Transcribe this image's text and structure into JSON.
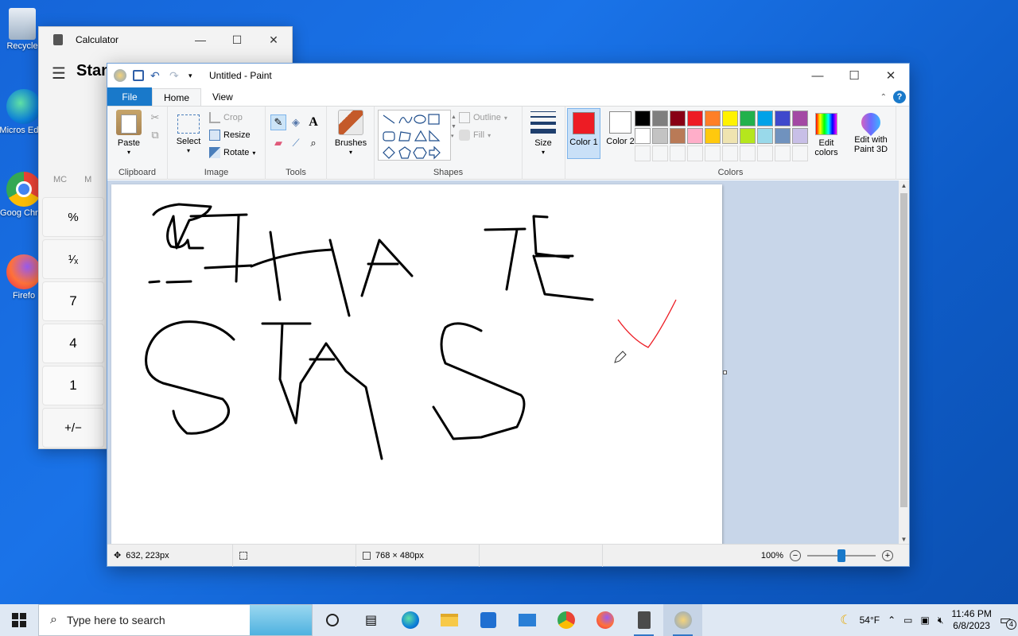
{
  "desktop": {
    "icons": [
      {
        "label": "Recycle",
        "icon": "recycle-bin-icon"
      },
      {
        "label": "Micros Edge",
        "icon": "edge-icon"
      },
      {
        "label": "Goog Chron",
        "icon": "chrome-icon"
      },
      {
        "label": "Firefo",
        "icon": "firefox-icon"
      }
    ]
  },
  "calculator": {
    "title": "Calculator",
    "mode": "Stan",
    "memory": [
      "MC",
      "M"
    ],
    "keys": [
      "%",
      "¹⁄ₓ",
      "7",
      "4",
      "1",
      "+/−"
    ],
    "controls": {
      "minimize": "—",
      "maximize": "☐",
      "close": "✕"
    }
  },
  "paint": {
    "title": "Untitled - Paint",
    "controls": {
      "minimize": "—",
      "maximize": "☐",
      "close": "✕"
    },
    "tabs": {
      "file": "File",
      "home": "Home",
      "view": "View"
    },
    "help": "?",
    "ribbon": {
      "clipboard": {
        "label": "Clipboard",
        "paste": "Paste"
      },
      "image": {
        "label": "Image",
        "select": "Select",
        "crop": "Crop",
        "resize": "Resize",
        "rotate": "Rotate"
      },
      "tools": {
        "label": "Tools",
        "text_glyph": "A"
      },
      "brushes": {
        "label": "Brushes"
      },
      "shapes": {
        "label": "Shapes",
        "outline": "Outline",
        "fill": "Fill"
      },
      "size": {
        "label": "Size"
      },
      "colors": {
        "label": "Colors",
        "color1": "Color 1",
        "color2": "Color 2",
        "color1_value": "#ed1c24",
        "color2_value": "#ffffff",
        "edit_colors": "Edit colors",
        "edit_paint3d": "Edit with Paint 3D",
        "palette_row1": [
          "#000000",
          "#7f7f7f",
          "#880015",
          "#ed1c24",
          "#ff7f27",
          "#fff200",
          "#22b14c",
          "#00a2e8",
          "#3f48cc",
          "#a349a4"
        ],
        "palette_row2": [
          "#ffffff",
          "#c3c3c3",
          "#b97a57",
          "#ffaec9",
          "#ffc90e",
          "#efe4b0",
          "#b5e61d",
          "#99d9ea",
          "#7092be",
          "#c8bfe7"
        ]
      }
    },
    "status": {
      "cursor_pos": "632, 223px",
      "canvas_size": "768 × 480px",
      "zoom": "100%",
      "zoom_minus": "−",
      "zoom_plus": "+"
    }
  },
  "taskbar": {
    "search_placeholder": "Type here to search",
    "weather": "54°F",
    "time": "11:46 PM",
    "date": "6/8/2023",
    "notifications": "4",
    "apps": [
      "task-view-icon",
      "widgets-icon",
      "edge-icon",
      "file-explorer-icon",
      "store-icon",
      "mail-icon",
      "chrome-icon",
      "firefox-icon",
      "calculator-icon",
      "paint-icon"
    ]
  }
}
